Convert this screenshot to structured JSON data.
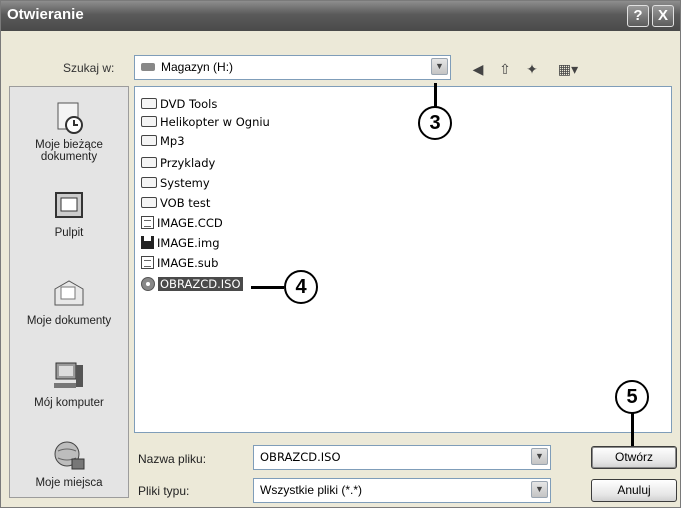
{
  "window": {
    "title": "Otwieranie"
  },
  "title_buttons": {
    "help": "?",
    "close": "X"
  },
  "lookin": {
    "label": "Szukaj w:",
    "value": "Magazyn (H:)"
  },
  "places": [
    {
      "label": "Moje bieżące dokumenty",
      "icon": "recent-documents-icon"
    },
    {
      "label": "Pulpit",
      "icon": "desktop-icon"
    },
    {
      "label": "Moje dokumenty",
      "icon": "my-documents-icon"
    },
    {
      "label": "Mój komputer",
      "icon": "my-computer-icon"
    },
    {
      "label": "Moje miejsca",
      "icon": "network-places-icon"
    }
  ],
  "files": [
    {
      "name": "DVD Tools",
      "type": "folder"
    },
    {
      "name": "Helikopter w Ogniu",
      "type": "folder"
    },
    {
      "name": "Mp3",
      "type": "folder"
    },
    {
      "name": "Przyklady",
      "type": "folder"
    },
    {
      "name": "Systemy",
      "type": "folder"
    },
    {
      "name": "VOB test",
      "type": "folder"
    },
    {
      "name": "IMAGE.CCD",
      "type": "doc"
    },
    {
      "name": "IMAGE.img",
      "type": "disk"
    },
    {
      "name": "IMAGE.sub",
      "type": "doc"
    },
    {
      "name": "OBRAZCD.ISO",
      "type": "cd",
      "selected": true
    }
  ],
  "filename": {
    "label": "Nazwa pliku:",
    "value": "OBRAZCD.ISO"
  },
  "filetype": {
    "label": "Pliki typu:",
    "value": "Wszystkie pliki (*.*)"
  },
  "buttons": {
    "open": "Otwórz",
    "cancel": "Anuluj"
  },
  "callouts": {
    "c3": "3",
    "c4": "4",
    "c5": "5"
  }
}
